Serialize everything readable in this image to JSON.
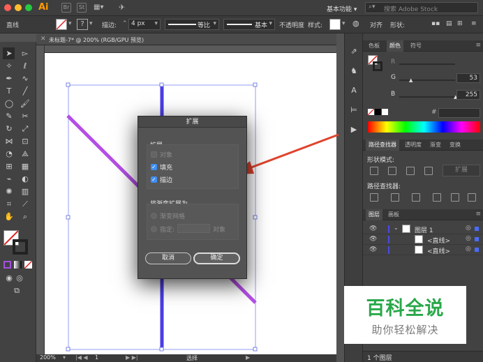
{
  "menubar": {
    "app_logo": "Ai",
    "workspace": "基本功能",
    "search_placeholder": "搜索 Adobe Stock"
  },
  "control_bar": {
    "selection_label": "直线",
    "stroke_label": "描边:",
    "stroke_value": "4 px",
    "profile_label": "等比",
    "brush_label": "基本",
    "opacity_label": "不透明度",
    "style_label": "样式:",
    "align_label": "对齐",
    "shape_label": "形状:"
  },
  "document": {
    "tab_title": "未标题-7* @ 200% (RGB/GPU 预览)",
    "zoom": "200%",
    "artboard_num": "1",
    "status": "选择"
  },
  "color_panel": {
    "tabs": [
      "色板",
      "颜色",
      "符号"
    ],
    "active_tab": 1,
    "r_label": "R",
    "g_label": "G",
    "b_label": "B",
    "g_value": "53",
    "b_value": "255",
    "hex_label": "#"
  },
  "pathfinder_panel": {
    "tabs": [
      "路径查找器",
      "透明度",
      "渐变",
      "变换"
    ],
    "active_tab": 0,
    "shape_modes_label": "形状模式:",
    "expand_button": "扩展",
    "pathfinders_label": "路径查找器:"
  },
  "layers_panel": {
    "tabs": [
      "图层",
      "画板"
    ],
    "active_tab": 0,
    "rows": [
      {
        "name": "图层 1"
      },
      {
        "name": "<直线>"
      },
      {
        "name": "<直线>"
      }
    ],
    "footer": "1 个图层"
  },
  "dialog": {
    "title": "扩展",
    "expand_group_label": "扩展",
    "object_label": "对象",
    "fill_label": "填充",
    "stroke_label": "描边",
    "gradient_group_label": "将渐变扩展为",
    "gradient_mesh_label": "渐变网格",
    "specify_label": "指定:",
    "specify_unit": "对象",
    "cancel_button": "取消",
    "ok_button": "确定",
    "object_checked": false,
    "fill_checked": true,
    "stroke_checked": true
  },
  "watermark": {
    "title": "百科全说",
    "subtitle": "助你轻松解决"
  },
  "colors": {
    "blue_line": "#4a3ee6",
    "purple_line": "#b44ee6",
    "arrow": "#e0432c",
    "checkbox": "#3f8ff2",
    "watermark_green": "#2aa84a"
  }
}
